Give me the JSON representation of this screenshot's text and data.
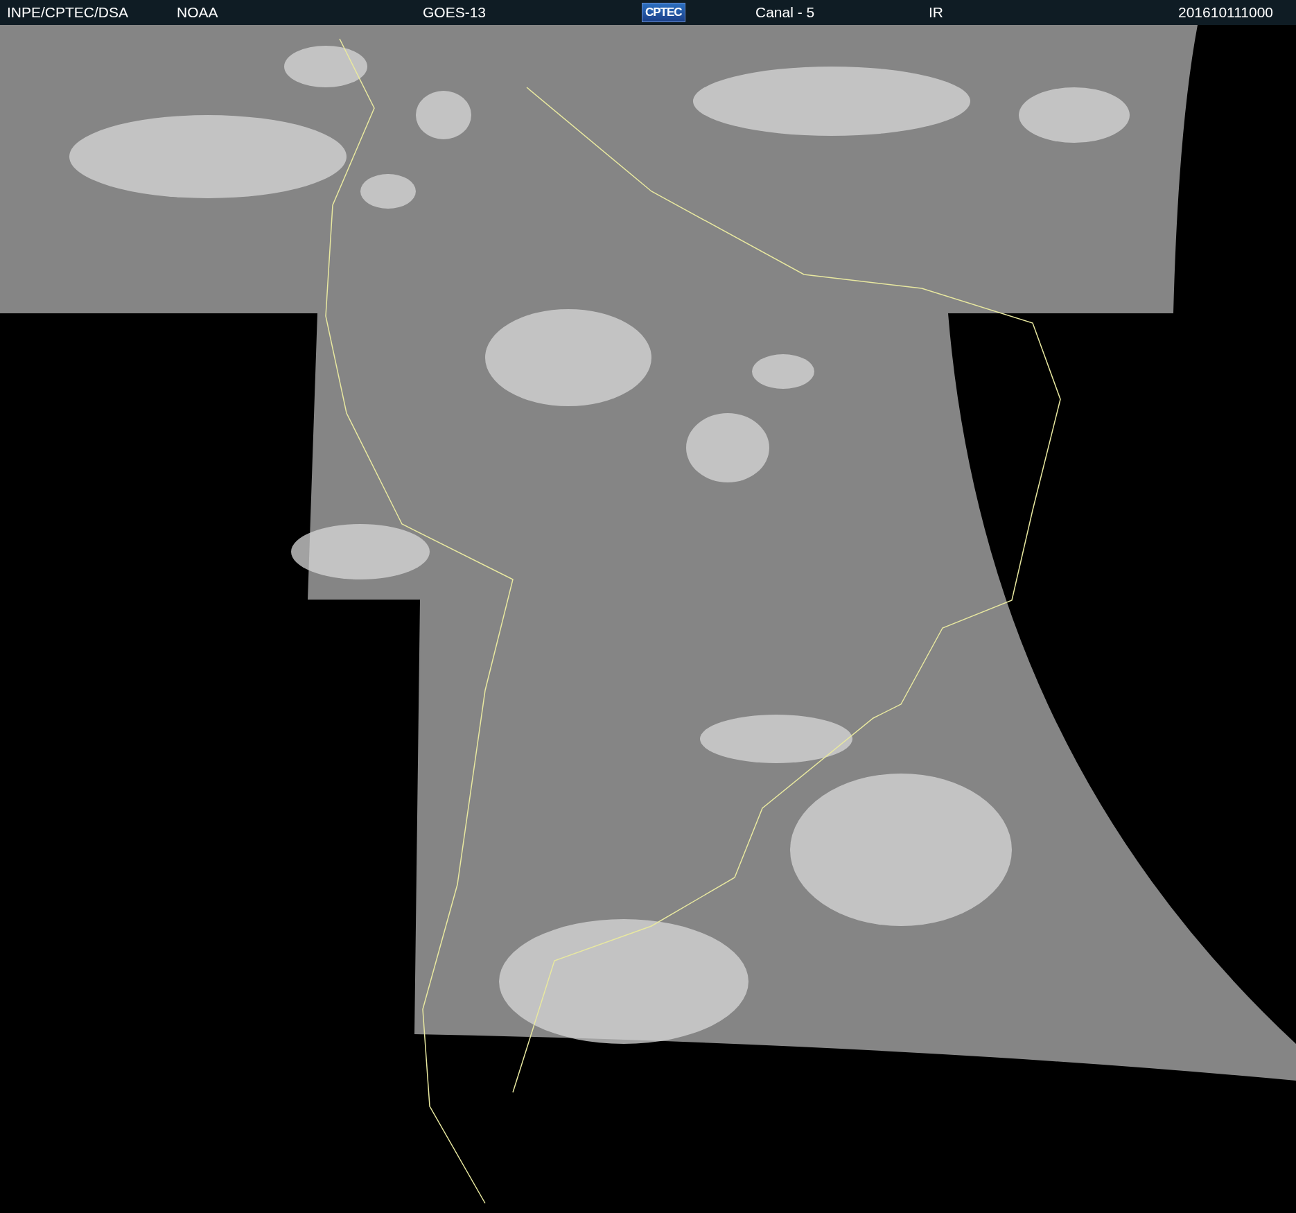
{
  "header": {
    "items": [
      {
        "text": "INPE/CPTEC/DSA",
        "kind": "text"
      },
      {
        "text": "NOAA",
        "kind": "text"
      },
      {
        "text": "GOES-13",
        "kind": "text"
      },
      {
        "text": "CPTEC",
        "kind": "logo"
      },
      {
        "text": "Canal - 5",
        "kind": "text"
      },
      {
        "text": "IR",
        "kind": "text"
      },
      {
        "text": "201610111000",
        "kind": "text"
      }
    ]
  }
}
